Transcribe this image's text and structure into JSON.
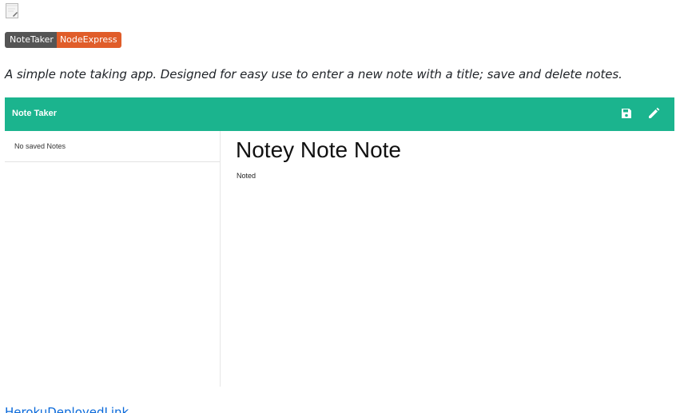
{
  "readme": {
    "badge": {
      "label": "NoteTaker",
      "message": "NodeExpress",
      "label_color": "#555555",
      "message_color": "#e05d2a"
    },
    "description": "A simple note taking app. Designed for easy use to enter a new note with a title; save and delete notes.",
    "link_text": "HerokuDeployedLink",
    "link_color": "#0969da",
    "image_icon": "broken-image-icon"
  },
  "app": {
    "title": "Note Taker",
    "accent_color": "#1bb48e",
    "toolbar": {
      "save_icon": "save-icon",
      "edit_icon": "pencil-icon"
    },
    "sidebar": {
      "empty_text": "No saved Notes"
    },
    "note": {
      "title": "Notey Note Note",
      "body": "Noted"
    }
  }
}
